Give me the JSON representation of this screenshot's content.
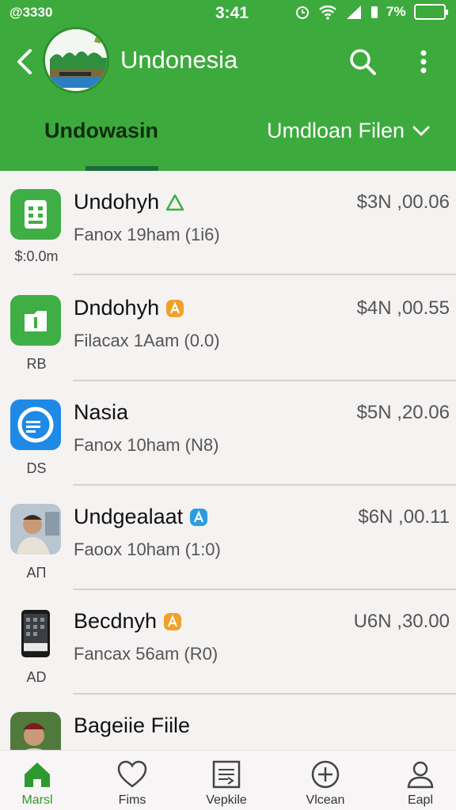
{
  "status_bar": {
    "left_text": "@3330",
    "time": "3:41",
    "battery_text": "7%"
  },
  "header": {
    "title": "Undonesia"
  },
  "tabs": {
    "left_label": "Undowasin",
    "right_label": "Umdloan Filen"
  },
  "colors": {
    "header_green": "#3daa3d",
    "nav_active": "#2c9a2c"
  },
  "rows": [
    {
      "name": "Undohyh",
      "sub": "Fanox 19ham (1i6)",
      "amount": "$3N ,00.06",
      "code": "$:0.0m",
      "badge": "triangle-outline-icon",
      "icon": "building-app-icon"
    },
    {
      "name": "Dndohyh",
      "sub": "Filacax 1Aam (0.0)",
      "amount": "$4N ,00.55",
      "code": "RB",
      "badge": "orange-a-badge-icon",
      "icon": "folder-app-icon"
    },
    {
      "name": "Nasia",
      "sub": "Fanox 10ham (N8)",
      "amount": "$5N ,20.06",
      "code": "DS",
      "badge": "",
      "icon": "blue-chart-app-icon"
    },
    {
      "name": "Undgealaat",
      "sub": "Faoox 10ham (1:0)",
      "amount": "$6N ,00.11",
      "code": "AП",
      "badge": "blue-a-badge-icon",
      "icon": "person-photo-icon"
    },
    {
      "name": "Becdnyh",
      "sub": "Fancax 56am (R0)",
      "amount": "U6N ,30.00",
      "code": "AD",
      "badge": "orange-a-badge-icon",
      "icon": "phone-photo-icon"
    },
    {
      "name": "Bageiie Fiile",
      "sub": "",
      "amount": "",
      "code": "",
      "badge": "",
      "icon": "person-photo-icon"
    }
  ],
  "bottom_nav": [
    {
      "label": "Marsl",
      "icon": "home-icon",
      "active": true
    },
    {
      "label": "Fims",
      "icon": "heart-icon",
      "active": false
    },
    {
      "label": "Vepkile",
      "icon": "document-icon",
      "active": false
    },
    {
      "label": "Vlcean",
      "icon": "plus-circle-icon",
      "active": false
    },
    {
      "label": "Eapl",
      "icon": "user-icon",
      "active": false
    }
  ]
}
